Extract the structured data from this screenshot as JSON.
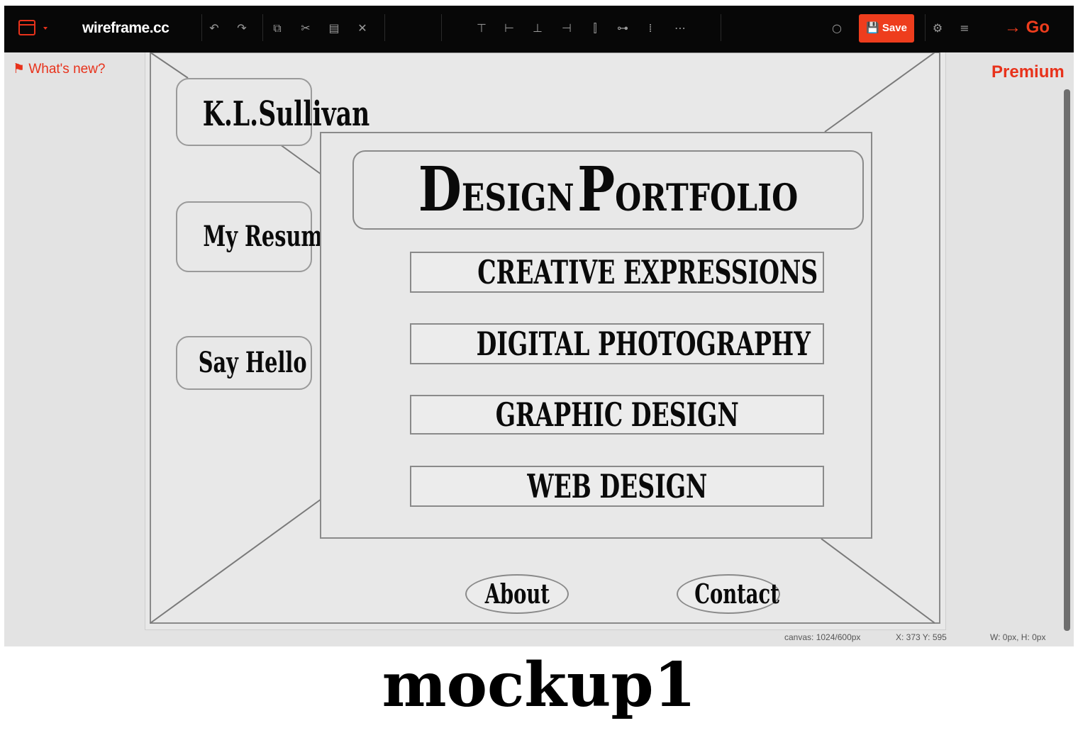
{
  "toolbar": {
    "brand": "wireframe.cc",
    "save_label": "Save",
    "go_label": "Go",
    "icons": [
      "app-menu-icon",
      "undo-icon",
      "redo-icon",
      "copy-icon",
      "cut-icon",
      "paste-icon",
      "delete-icon",
      "align-top-icon",
      "align-left-icon",
      "align-bottom-icon",
      "align-right-icon",
      "align-center-v-icon",
      "align-center-h-icon",
      "distribute-v-icon",
      "distribute-h-icon",
      "comment-icon",
      "settings-icon",
      "list-icon"
    ]
  },
  "left_panel": {
    "whats_new": "What's new?"
  },
  "right_panel": {
    "premium": "Premium"
  },
  "status": {
    "canvas": "canvas: 1024/600px",
    "coords": "X: 373 Y: 595",
    "size": "W: 0px, H: 0px"
  },
  "mockup": {
    "name": "K.L.Sullivan",
    "resume": "My Resume",
    "hello": "Say Hello",
    "title_d": "D",
    "title_esign": "ESIGN",
    "title_p": "P",
    "title_ortfolio": "ORTFOLIO",
    "menu": [
      "CREATIVE EXPRESSIONS",
      "DIGITAL PHOTOGRAPHY",
      "GRAPHIC DESIGN",
      "WEB DESIGN"
    ],
    "about": "About",
    "contact": "Contact"
  },
  "caption": "mockup1",
  "colors": {
    "accent": "#ee3d1d",
    "toolbar_bg": "#070707",
    "canvas_bg": "#e8e8e8"
  }
}
